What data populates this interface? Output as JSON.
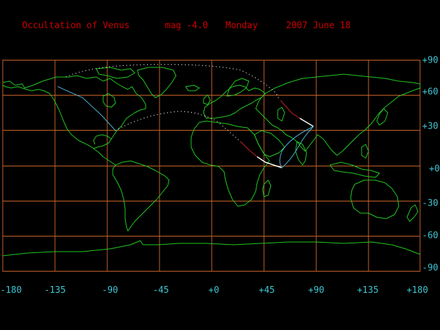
{
  "header": {
    "title": "Occultation of Venus",
    "magnitude": "mag -4.0",
    "weekday": "Monday",
    "date": "2007 June 18"
  },
  "axes": {
    "longitude_labels": [
      "-180",
      "-135",
      "-90",
      "-45",
      "+0",
      "+45",
      "+90",
      "+135",
      "+180"
    ],
    "latitude_labels": [
      "+90",
      "+60",
      "+30",
      "+0",
      "-30",
      "-60",
      "-90"
    ]
  },
  "colors": {
    "background": "#000000",
    "grid": "#c8642a",
    "coastline": "#22cc22",
    "header_text": "#cc0000",
    "axis_text": "#3fc4d0",
    "occultation_limit": "#ffffff",
    "graze_line": "#4fb4d8",
    "daylight_track": "#cc2222"
  }
}
